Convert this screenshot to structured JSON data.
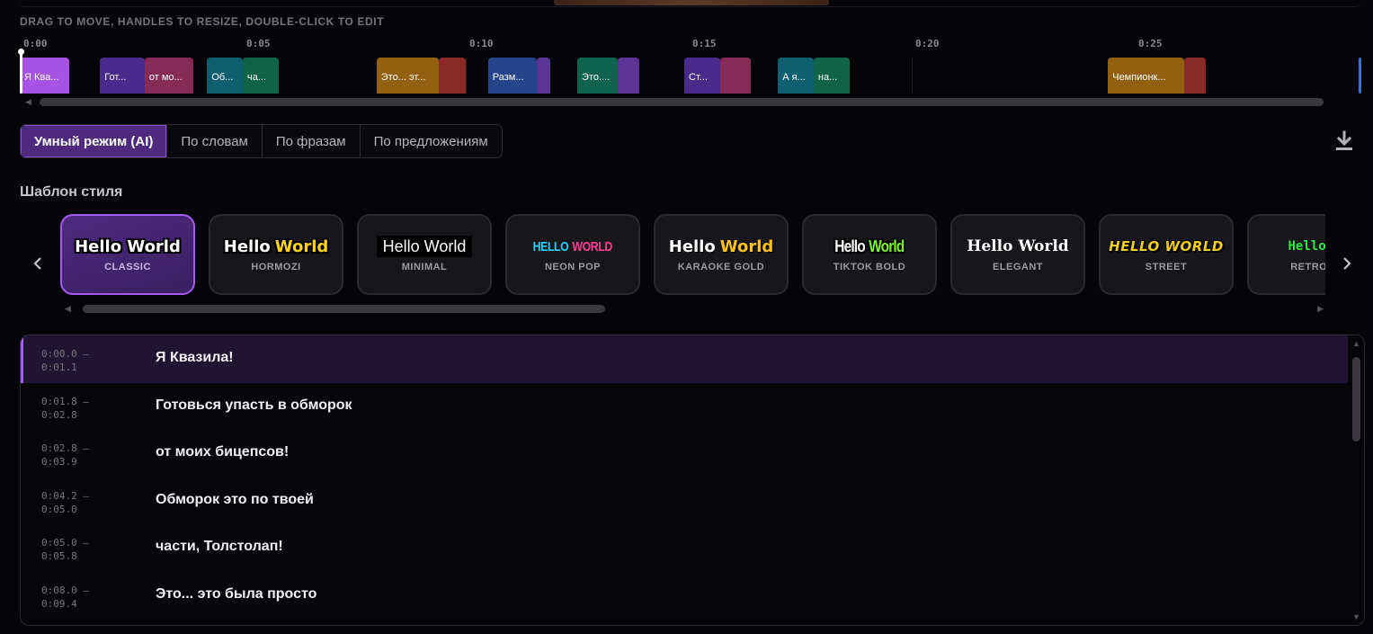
{
  "hint": "DRAG TO MOVE, HANDLES TO RESIZE, DOUBLE-CLICK TO EDIT",
  "ruler": {
    "ticks": [
      "0:00",
      "0:05",
      "0:10",
      "0:15",
      "0:20",
      "0:25"
    ],
    "seconds_per_tick": 5,
    "total_seconds": 30
  },
  "clips": [
    {
      "label": "Я Ква...",
      "start": 0.0,
      "end": 1.1,
      "color": "#a753e6"
    },
    {
      "label": "Гот...",
      "start": 1.8,
      "end": 2.8,
      "color": "#4a2a8a"
    },
    {
      "label": "от мо...",
      "start": 2.8,
      "end": 3.9,
      "color": "#862a57"
    },
    {
      "label": "Об...",
      "start": 4.2,
      "end": 5.0,
      "color": "#0e5f70"
    },
    {
      "label": "ча...",
      "start": 5.0,
      "end": 5.8,
      "color": "#0f6448"
    },
    {
      "label": "Это... эт...",
      "start": 8.0,
      "end": 9.4,
      "color": "#92600f"
    },
    {
      "label": "",
      "start": 9.4,
      "end": 10.0,
      "color": "#8a2a28"
    },
    {
      "label": "Разм...",
      "start": 10.5,
      "end": 11.6,
      "color": "#26448c"
    },
    {
      "label": "",
      "start": 11.6,
      "end": 11.9,
      "color": "#5a3596"
    },
    {
      "label": "Это....",
      "start": 12.5,
      "end": 13.4,
      "color": "#0f6450"
    },
    {
      "label": "",
      "start": 13.4,
      "end": 13.9,
      "color": "#5a3596"
    },
    {
      "label": "Ст...",
      "start": 14.9,
      "end": 15.7,
      "color": "#4a2a8a"
    },
    {
      "label": "",
      "start": 15.7,
      "end": 16.4,
      "color": "#862a57"
    },
    {
      "label": "А я...",
      "start": 17.0,
      "end": 17.8,
      "color": "#0e5f70"
    },
    {
      "label": "на...",
      "start": 17.8,
      "end": 18.6,
      "color": "#0f6448"
    },
    {
      "label": "Чемпионк...",
      "start": 24.4,
      "end": 26.1,
      "color": "#92600f"
    },
    {
      "label": "",
      "start": 26.1,
      "end": 26.6,
      "color": "#8a2a28"
    }
  ],
  "modes": [
    {
      "label": "Умный режим (AI)",
      "active": true
    },
    {
      "label": "По словам",
      "active": false
    },
    {
      "label": "По фразам",
      "active": false
    },
    {
      "label": "По предложениям",
      "active": false
    }
  ],
  "templates_title": "Шаблон стиля",
  "templates": [
    {
      "name": "CLASSIC",
      "style": "classic",
      "words": [
        {
          "text": "Hello World",
          "color": "#ffffff"
        }
      ],
      "active": true
    },
    {
      "name": "HORMOZI",
      "style": "hormozi",
      "words": [
        {
          "text": "Hello",
          "color": "#ffffff"
        },
        {
          "text": "World",
          "color": "#ffd21c"
        }
      ],
      "active": false
    },
    {
      "name": "MINIMAL",
      "style": "minimal",
      "words": [
        {
          "text": "Hello World",
          "color": "#ffffff"
        }
      ],
      "active": false
    },
    {
      "name": "NEON POP",
      "style": "neon",
      "words": [
        {
          "text": "HELLO",
          "color": "#2ad0ff"
        },
        {
          "text": "WORLD",
          "color": "#ff3f9a"
        }
      ],
      "active": false
    },
    {
      "name": "KARAOKE GOLD",
      "style": "karaoke",
      "words": [
        {
          "text": "Hello",
          "color": "#ffffff"
        },
        {
          "text": "World",
          "color": "#ffc21c"
        }
      ],
      "active": false
    },
    {
      "name": "TIKTOK BOLD",
      "style": "tiktok",
      "words": [
        {
          "text": "Hello",
          "color": "#ffffff"
        },
        {
          "text": "World",
          "color": "#7cf22c"
        }
      ],
      "active": false
    },
    {
      "name": "ELEGANT",
      "style": "elegant",
      "words": [
        {
          "text": "Hello World",
          "color": "#ffffff"
        }
      ],
      "active": false
    },
    {
      "name": "STREET",
      "style": "street",
      "words": [
        {
          "text": "HELLO WORLD",
          "color": "#f2cf1e"
        }
      ],
      "active": false
    },
    {
      "name": "RETRO G",
      "style": "retro",
      "words": [
        {
          "text": "Hello W",
          "color": "#2fe84a"
        }
      ],
      "active": false
    }
  ],
  "subtitles": [
    {
      "start": "0:00.0 –",
      "end": "0:01.1",
      "text": "Я Квазила!",
      "active": true
    },
    {
      "start": "0:01.8 –",
      "end": "0:02.8",
      "text": "Готовься упасть в обморок",
      "active": false
    },
    {
      "start": "0:02.8 –",
      "end": "0:03.9",
      "text": "от моих бицепсов!",
      "active": false
    },
    {
      "start": "0:04.2 –",
      "end": "0:05.0",
      "text": "Обморок это по твоей",
      "active": false
    },
    {
      "start": "0:05.0 –",
      "end": "0:05.8",
      "text": "части, Толстолап!",
      "active": false
    },
    {
      "start": "0:08.0 –",
      "end": "0:09.4",
      "text": "Это... это была просто",
      "active": false
    }
  ],
  "colors": {
    "accent": "#a25cf0",
    "accent_bg": "#4d2a7c",
    "background": "#050407"
  },
  "icons": {
    "download": "download-icon",
    "prev": "chevron-left-icon",
    "next": "chevron-right-icon"
  }
}
